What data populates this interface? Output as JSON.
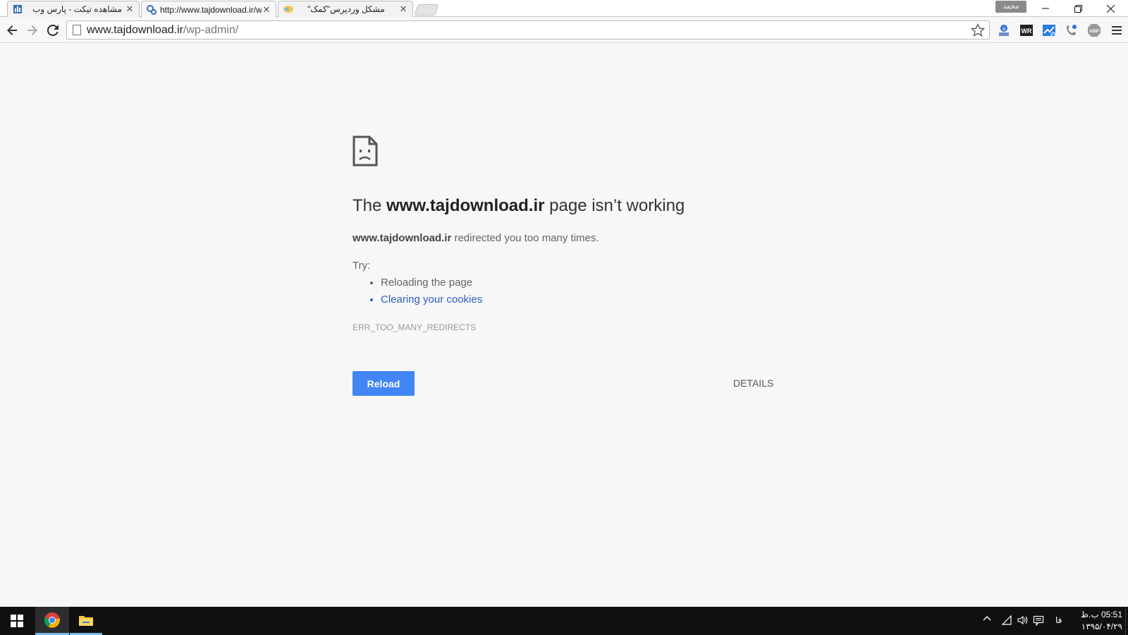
{
  "tabs": [
    {
      "title": "مشاهده تیکت - پارس وب",
      "favicon": "ticket-favicon",
      "active": false
    },
    {
      "title": "http://www.tajdownload.ir/wp-admin/",
      "favicon": "wordpress-favicon",
      "active": true
    },
    {
      "title": "مشکل وردپرس\"کمک\"",
      "favicon": "forum-favicon",
      "active": false
    }
  ],
  "profile_name": "محمد",
  "address_bar": {
    "host": "www.tajdownload.ir",
    "path": "/wp-admin/"
  },
  "extensions": [
    "alexa-icon",
    "wr-icon",
    "stats-icon",
    "phone-icon",
    "adblock-icon"
  ],
  "extension_labels": {
    "wr": "WR",
    "abp": "ABP"
  },
  "error_page": {
    "heading_prefix": "The ",
    "heading_host": "www.tajdownload.ir",
    "heading_suffix": " page isn’t working",
    "desc_host": "www.tajdownload.ir",
    "desc_suffix": " redirected you too many times.",
    "try_label": "Try:",
    "suggestions": [
      "Reloading the page",
      "Clearing your cookies"
    ],
    "error_code": "ERR_TOO_MANY_REDIRECTS",
    "reload_label": "Reload",
    "details_label": "DETAILS"
  },
  "taskbar": {
    "lang": "فا",
    "time": "05:51 ب.ظ",
    "date": "۱۳۹۵/۰۴/۲۹"
  },
  "colors": {
    "accent_blue": "#4285f4",
    "link_blue": "#2c5ec5",
    "page_bg": "#f7f7f7",
    "taskbar_bg": "#101010"
  }
}
